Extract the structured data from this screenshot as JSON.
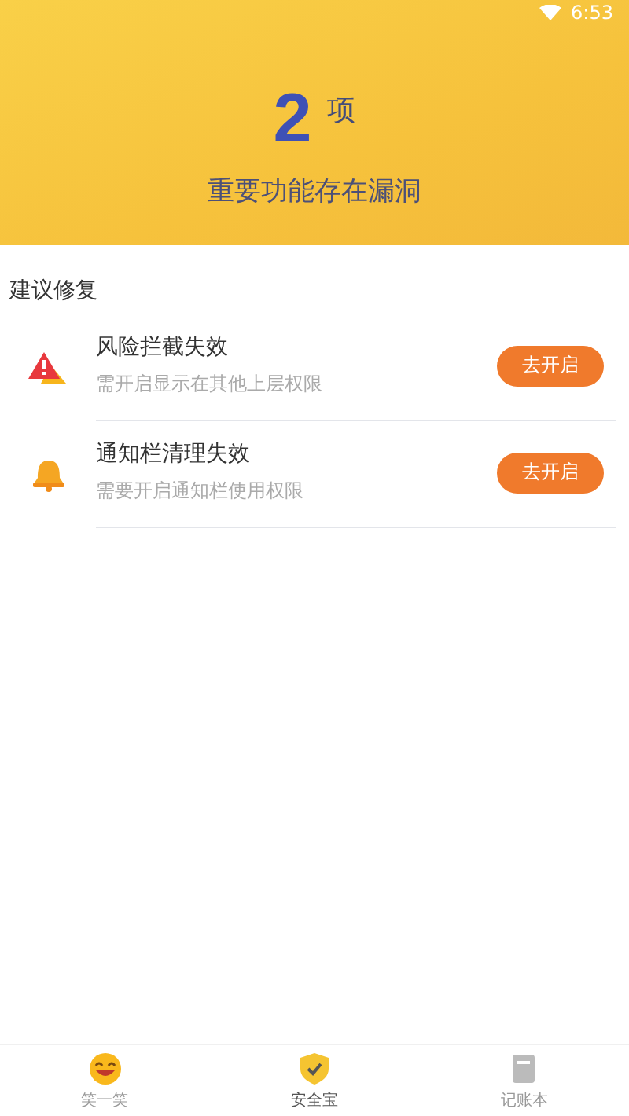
{
  "status_bar": {
    "time": "6:53"
  },
  "header": {
    "count": "2",
    "unit": "项",
    "subtitle": "重要功能存在漏洞"
  },
  "section": {
    "title": "建议修复"
  },
  "issues": [
    {
      "kind": "warning",
      "title": "风险拦截失效",
      "description": "需开启显示在其他上层权限",
      "action": "去开启"
    },
    {
      "kind": "bell",
      "title": "通知栏清理失效",
      "description": "需要开启通知栏使用权限",
      "action": "去开启"
    }
  ],
  "nav": [
    {
      "kind": "smile",
      "label": "笑一笑",
      "selected": false
    },
    {
      "kind": "shield",
      "label": "安全宝",
      "selected": true
    },
    {
      "kind": "book",
      "label": "记账本",
      "selected": false
    }
  ]
}
